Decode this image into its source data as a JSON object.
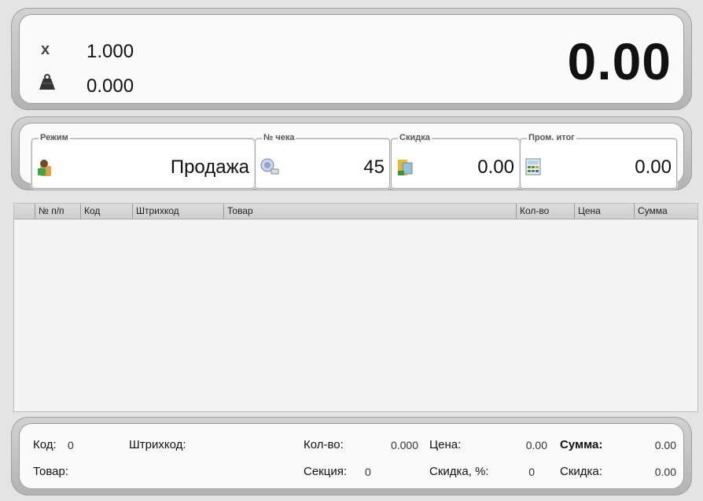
{
  "top": {
    "qty_icon": "x",
    "qty_value": "1.000",
    "weight_value": "0.000",
    "total": "0.00"
  },
  "info": {
    "mode": {
      "legend": "Режим",
      "value": "Продажа"
    },
    "check": {
      "legend": "№ чека",
      "value": "45"
    },
    "discount": {
      "legend": "Скидка",
      "value": "0.00"
    },
    "subtotal": {
      "legend": "Пром. итог",
      "value": "0.00"
    }
  },
  "table": {
    "columns": [
      "№ п/п",
      "Код",
      "Штрихкод",
      "Товар",
      "Кол-во",
      "Цена",
      "Сумма"
    ]
  },
  "bottom": {
    "code_label": "Код:",
    "code_value": "0",
    "barcode_label": "Штрихкод:",
    "qty_label": "Кол-во:",
    "qty_value": "0.000",
    "price_label": "Цена:",
    "price_value": "0.00",
    "sum_label": "Сумма:",
    "sum_value": "0.00",
    "item_label": "Товар:",
    "section_label": "Секция:",
    "section_value": "0",
    "discount_pct_label": "Скидка, %:",
    "discount_pct_value": "0",
    "discount_label": "Скидка:",
    "discount_value": "0.00"
  },
  "icons": {
    "weight": "weight-icon",
    "mode": "cashier-icon",
    "check": "receipt-icon",
    "discount": "discount-icon",
    "subtotal": "calculator-icon"
  }
}
